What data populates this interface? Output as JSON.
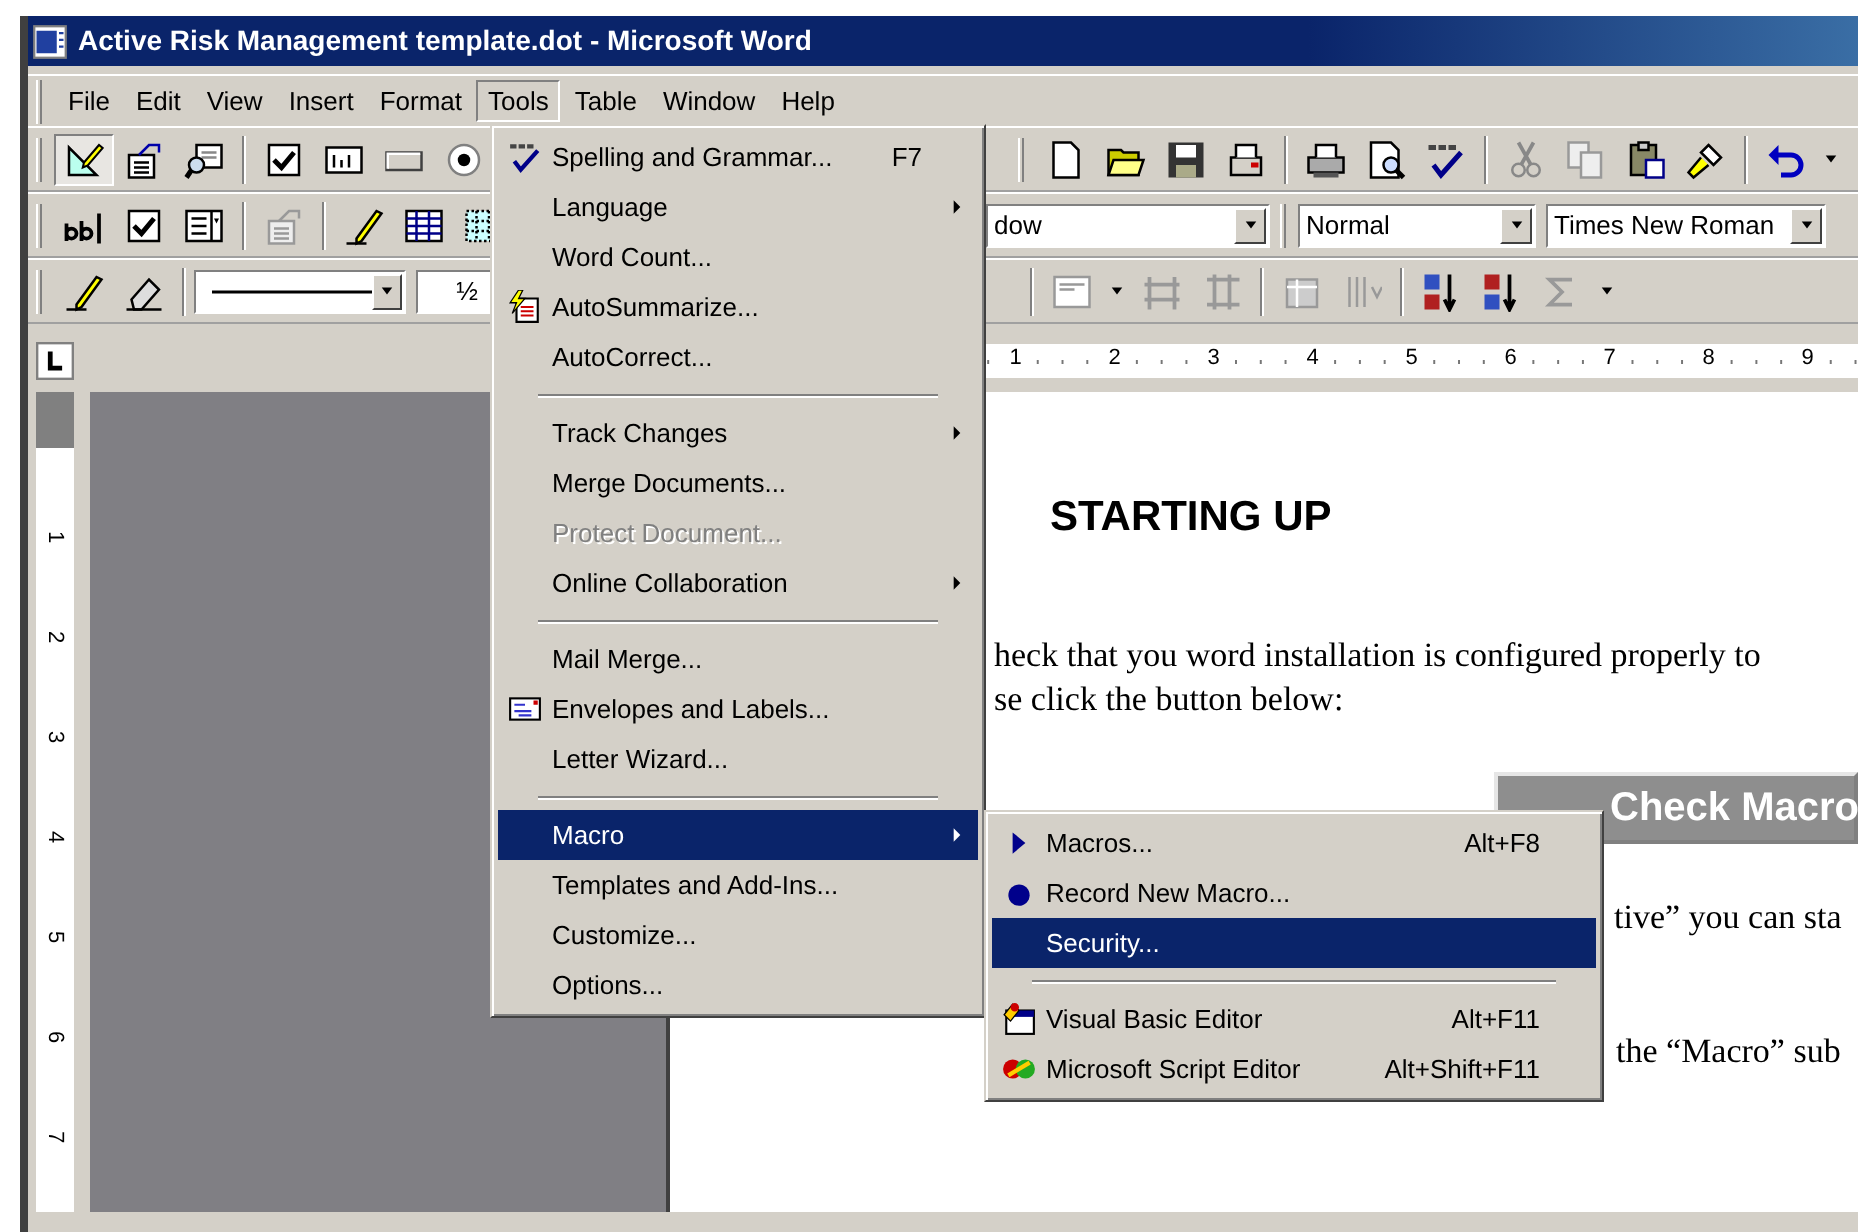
{
  "window": {
    "title": "Active Risk Management template.dot - Microsoft Word"
  },
  "menu_bar": [
    {
      "label": "File",
      "selected": false
    },
    {
      "label": "Edit",
      "selected": false
    },
    {
      "label": "View",
      "selected": false
    },
    {
      "label": "Insert",
      "selected": false
    },
    {
      "label": "Format",
      "selected": false
    },
    {
      "label": "Tools",
      "selected": true
    },
    {
      "label": "Table",
      "selected": false
    },
    {
      "label": "Window",
      "selected": false
    },
    {
      "label": "Help",
      "selected": false
    }
  ],
  "toolbars": {
    "design_mode": {
      "pressed": true
    },
    "style": "dow",
    "paragraph_style": "Normal",
    "font": "Times New Roman",
    "line_weight": "½"
  },
  "rulers": {
    "horizontal": [
      "1",
      "2",
      "3",
      "4",
      "5",
      "6",
      "7",
      "8",
      "9"
    ],
    "vertical": [
      "1",
      "2",
      "3",
      "4",
      "5",
      "6",
      "7"
    ]
  },
  "document": {
    "heading": "STARTING UP",
    "lines": [
      "heck that you word installation is configured properly to",
      "se click the button below:"
    ],
    "button": "Check Macro",
    "lines_below": [
      "tive” you can sta",
      "the “Macro” sub"
    ]
  },
  "tools_menu": {
    "items": [
      {
        "kind": "item",
        "label": "Spelling and Grammar...",
        "shortcut": "F7",
        "submenu": false,
        "disabled": false,
        "selected": false
      },
      {
        "kind": "item",
        "label": "Language",
        "submenu": true,
        "disabled": false,
        "selected": false
      },
      {
        "kind": "item",
        "label": "Word Count...",
        "submenu": false,
        "disabled": false,
        "selected": false
      },
      {
        "kind": "item",
        "label": "AutoSummarize...",
        "submenu": false,
        "disabled": false,
        "selected": false
      },
      {
        "kind": "item",
        "label": "AutoCorrect...",
        "submenu": false,
        "disabled": false,
        "selected": false
      },
      {
        "kind": "separator"
      },
      {
        "kind": "item",
        "label": "Track Changes",
        "submenu": true,
        "disabled": false,
        "selected": false
      },
      {
        "kind": "item",
        "label": "Merge Documents...",
        "submenu": false,
        "disabled": false,
        "selected": false
      },
      {
        "kind": "item",
        "label": "Protect Document...",
        "submenu": false,
        "disabled": true,
        "selected": false
      },
      {
        "kind": "item",
        "label": "Online Collaboration",
        "submenu": true,
        "disabled": false,
        "selected": false
      },
      {
        "kind": "separator"
      },
      {
        "kind": "item",
        "label": "Mail Merge...",
        "submenu": false,
        "disabled": false,
        "selected": false
      },
      {
        "kind": "item",
        "label": "Envelopes and Labels...",
        "submenu": false,
        "disabled": false,
        "selected": false
      },
      {
        "kind": "item",
        "label": "Letter Wizard...",
        "submenu": false,
        "disabled": false,
        "selected": false
      },
      {
        "kind": "separator"
      },
      {
        "kind": "item",
        "label": "Macro",
        "submenu": true,
        "disabled": false,
        "selected": true
      },
      {
        "kind": "item",
        "label": "Templates and Add-Ins...",
        "submenu": false,
        "disabled": false,
        "selected": false
      },
      {
        "kind": "item",
        "label": "Customize...",
        "submenu": false,
        "disabled": false,
        "selected": false
      },
      {
        "kind": "item",
        "label": "Options...",
        "submenu": false,
        "disabled": false,
        "selected": false
      }
    ]
  },
  "macro_submenu": {
    "items": [
      {
        "kind": "item",
        "label": "Macros...",
        "shortcut": "Alt+F8",
        "disabled": false,
        "selected": false
      },
      {
        "kind": "item",
        "label": "Record New Macro...",
        "disabled": false,
        "selected": false
      },
      {
        "kind": "item",
        "label": "Security...",
        "disabled": false,
        "selected": true
      },
      {
        "kind": "separator"
      },
      {
        "kind": "item",
        "label": "Visual Basic Editor",
        "shortcut": "Alt+F11",
        "disabled": false,
        "selected": false
      },
      {
        "kind": "item",
        "label": "Microsoft Script Editor",
        "shortcut": "Alt+Shift+F11",
        "disabled": false,
        "selected": false
      }
    ]
  }
}
